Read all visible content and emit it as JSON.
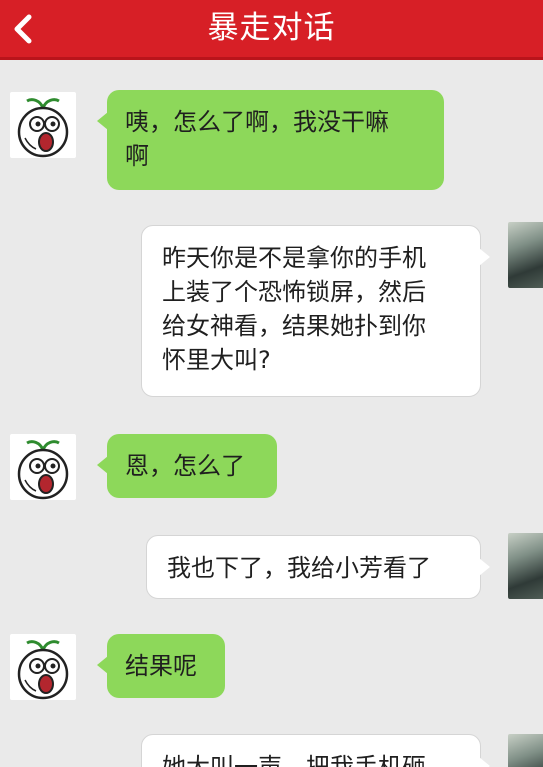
{
  "header": {
    "title": "暴走对话",
    "back_icon": "chevron-left-icon",
    "background": "#d71f26"
  },
  "colors": {
    "incoming_bubble": "#8dd85a",
    "outgoing_bubble": "#ffffff",
    "chat_background": "#eaeaea"
  },
  "messages": [
    {
      "side": "left",
      "avatar_icon": "rage-face-sprout-avatar",
      "text": "咦，怎么了啊，我没干嘛\n啊"
    },
    {
      "side": "right",
      "avatar_icon": "warrior-photo-avatar",
      "text": "昨天你是不是拿你的手机\n上装了个恐怖锁屏，然后\n给女神看，结果她扑到你\n怀里大叫?"
    },
    {
      "side": "left",
      "avatar_icon": "rage-face-sprout-avatar",
      "text": "恩，怎么了"
    },
    {
      "side": "right",
      "avatar_icon": "warrior-photo-avatar",
      "text": "我也下了，我给小芳看了"
    },
    {
      "side": "left",
      "avatar_icon": "rage-face-sprout-avatar",
      "text": "结果呢"
    },
    {
      "side": "right",
      "avatar_icon": "warrior-photo-avatar",
      "text": "她大叫一声，把我手机砸"
    }
  ]
}
